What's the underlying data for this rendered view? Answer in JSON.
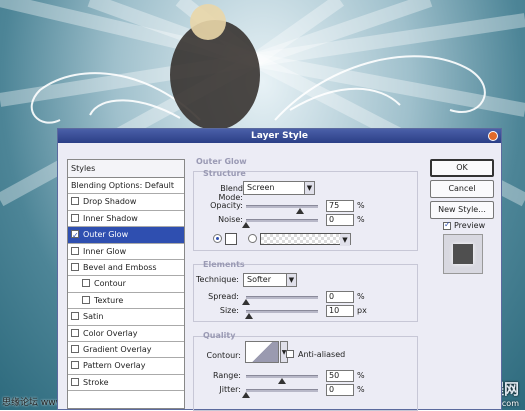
{
  "dialog": {
    "title": "Layer Style"
  },
  "styles": {
    "header": "Styles",
    "items": [
      {
        "label": "Blending Options: Default",
        "checkbox": false,
        "checked": false,
        "active": false,
        "sub": false
      },
      {
        "label": "Drop Shadow",
        "checkbox": true,
        "checked": false,
        "active": false,
        "sub": false
      },
      {
        "label": "Inner Shadow",
        "checkbox": true,
        "checked": false,
        "active": false,
        "sub": false
      },
      {
        "label": "Outer Glow",
        "checkbox": true,
        "checked": true,
        "active": true,
        "sub": false
      },
      {
        "label": "Inner Glow",
        "checkbox": true,
        "checked": false,
        "active": false,
        "sub": false
      },
      {
        "label": "Bevel and Emboss",
        "checkbox": true,
        "checked": false,
        "active": false,
        "sub": false
      },
      {
        "label": "Contour",
        "checkbox": true,
        "checked": false,
        "active": false,
        "sub": true
      },
      {
        "label": "Texture",
        "checkbox": true,
        "checked": false,
        "active": false,
        "sub": true
      },
      {
        "label": "Satin",
        "checkbox": true,
        "checked": false,
        "active": false,
        "sub": false
      },
      {
        "label": "Color Overlay",
        "checkbox": true,
        "checked": false,
        "active": false,
        "sub": false
      },
      {
        "label": "Gradient Overlay",
        "checkbox": true,
        "checked": false,
        "active": false,
        "sub": false
      },
      {
        "label": "Pattern Overlay",
        "checkbox": true,
        "checked": false,
        "active": false,
        "sub": false
      },
      {
        "label": "Stroke",
        "checkbox": true,
        "checked": false,
        "active": false,
        "sub": false
      }
    ]
  },
  "outer_glow": {
    "section_title": "Outer Glow",
    "structure": {
      "title": "Structure",
      "blend_mode_label": "Blend Mode:",
      "blend_mode_value": "Screen",
      "opacity_label": "Opacity:",
      "opacity_value": "75",
      "opacity_level": 0.75,
      "noise_label": "Noise:",
      "noise_value": "0",
      "noise_level": 0,
      "unit_percent": "%"
    },
    "elements": {
      "title": "Elements",
      "technique_label": "Technique:",
      "technique_value": "Softer",
      "spread_label": "Spread:",
      "spread_value": "0",
      "spread_level": 0,
      "size_label": "Size:",
      "size_value": "10",
      "size_level": 0.04,
      "unit_percent": "%",
      "unit_px": "px"
    },
    "quality": {
      "title": "Quality",
      "contour_label": "Contour:",
      "anti_aliased_label": "Anti-aliased",
      "anti_aliased_checked": false,
      "range_label": "Range:",
      "range_value": "50",
      "range_level": 0.5,
      "jitter_label": "Jitter:",
      "jitter_value": "0",
      "jitter_level": 0,
      "unit_percent": "%"
    }
  },
  "buttons": {
    "ok": "OK",
    "cancel": "Cancel",
    "new_style": "New Style...",
    "preview_label": "Preview",
    "preview_checked": true
  },
  "watermarks": {
    "left": "思缘论坛 www.missyuan.com",
    "right_main": "查字典 教程网",
    "right_sub": "jiaocheng.chazidian.com"
  },
  "colors": {
    "accent": "#2f4fb0",
    "titlebar": "#2b3f86",
    "close": "#e06a2a"
  }
}
